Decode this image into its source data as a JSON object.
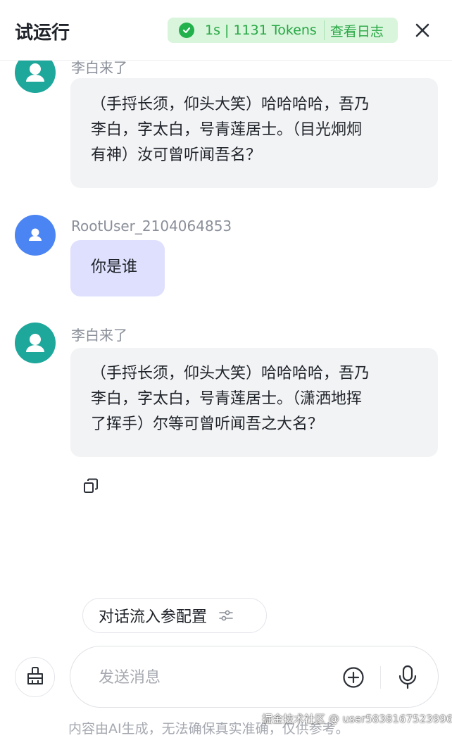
{
  "header": {
    "title": "试运行",
    "status_text": "1s | 1131 Tokens",
    "log_link": "查看日志",
    "icons": {
      "status": "check-circle-icon",
      "close": "close-icon"
    },
    "colors": {
      "status_bg": "#d9f5dc",
      "status_text": "#27a844"
    }
  },
  "messages": [
    {
      "sender": "李白来了",
      "role": "bot",
      "lines": [
        "（手捋长须，仰头大笑）哈哈哈哈，吾乃",
        "李白，字太白，号青莲居士。（目光炯炯",
        "有神）汝可曾听闻吾名？"
      ]
    },
    {
      "sender": "RootUser_2104064853",
      "role": "user",
      "lines": [
        "你是谁"
      ]
    },
    {
      "sender": "李白来了",
      "role": "bot",
      "lines": [
        "（手捋长须，仰头大笑）哈哈哈哈，吾乃",
        "李白，字太白，号青莲居士。（潇洒地挥",
        "了挥手）尔等可曾听闻吾之大名？"
      ]
    }
  ],
  "actions": {
    "copy_icon": "copy-icon"
  },
  "config": {
    "label": "对话流入参配置",
    "icon": "sliders-icon"
  },
  "composer": {
    "placeholder": "发送消息",
    "icons": {
      "clear": "broom-icon",
      "add": "plus-circle-icon",
      "mic": "microphone-icon"
    }
  },
  "footer": {
    "disclaimer": "内容由AI生成，无法确保真实准确，仅供参考。",
    "watermark": "掘金技术社区 @ user5838167523996"
  },
  "colors": {
    "bot_avatar": "#1ea79b",
    "user_avatar": "#4b84f3",
    "user_bubble": "#dfe0fd",
    "bot_bubble": "#f2f3f5"
  }
}
